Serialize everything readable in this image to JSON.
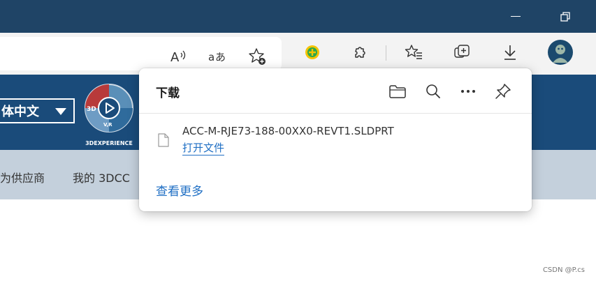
{
  "toolbar": {
    "icons": [
      "read-aloud-icon",
      "translate-icon",
      "add-favorite-icon",
      "extension-colored-icon",
      "extensions-icon",
      "favorites-icon",
      "collections-icon",
      "downloads-icon",
      "profile-avatar"
    ]
  },
  "site": {
    "language": "体中文",
    "logo_text": "3DEXPERIENCE",
    "logo_sub": "V,R",
    "logo_badge": "3D",
    "nav": [
      "为供应商",
      "我的 3DCC"
    ]
  },
  "downloads": {
    "title": "下载",
    "file_name": "ACC-M-RJE73-188-00XX0-REVT1.SLDPRT",
    "open_file": "打开文件",
    "see_more": "查看更多"
  },
  "watermark": "CSDN @P.cs",
  "colors": {
    "titlebar": "#1f4466",
    "banner": "#1a4b7a",
    "nav": "#c4d0dc",
    "link": "#1f6fc4"
  }
}
